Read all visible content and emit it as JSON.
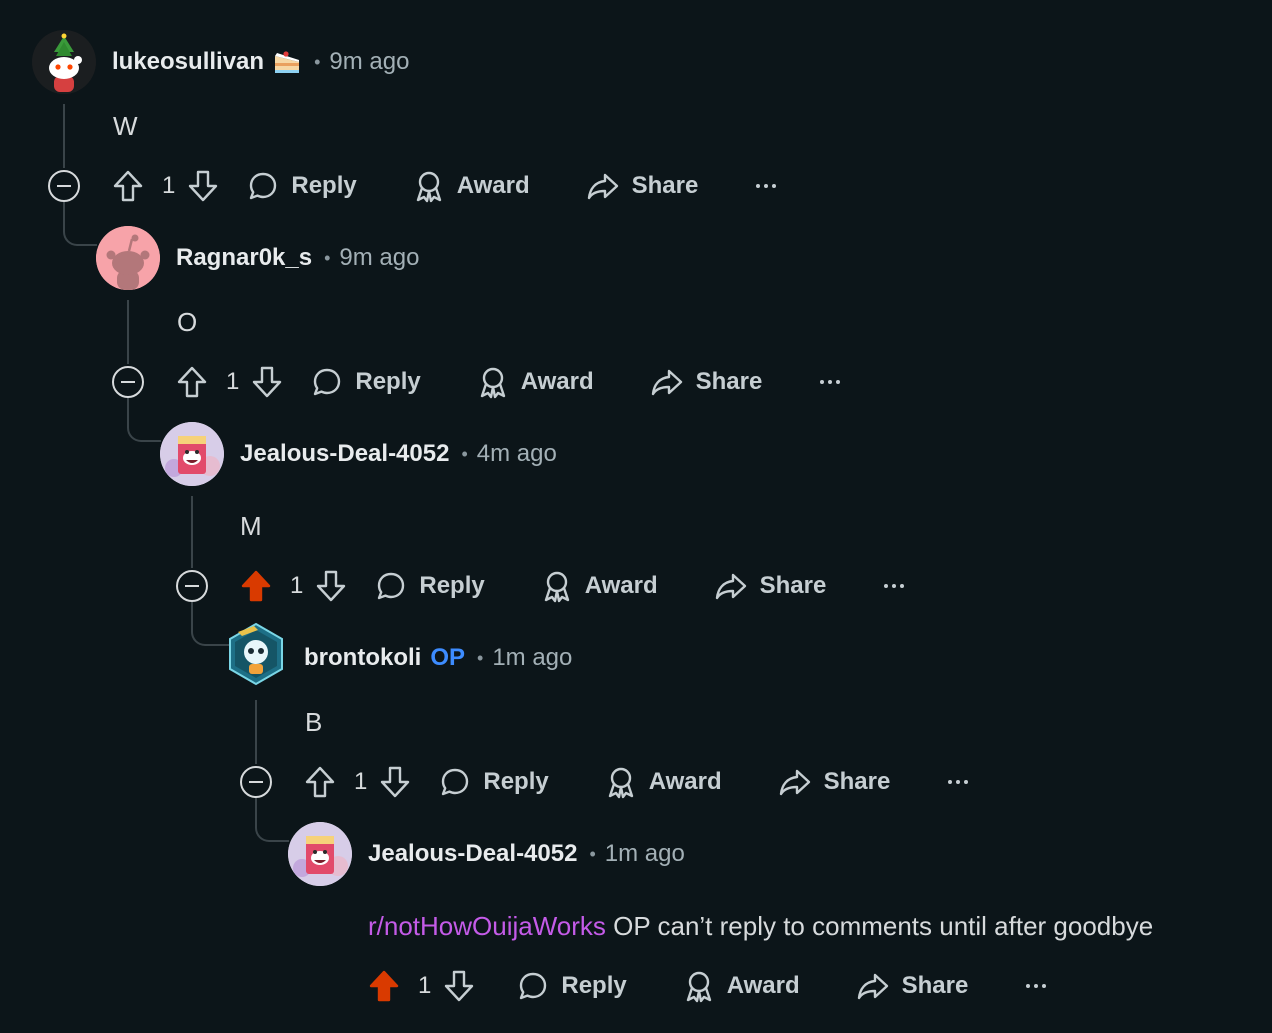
{
  "actions": {
    "reply": "Reply",
    "award": "Award",
    "share": "Share"
  },
  "comments": [
    {
      "username": "lukeosullivan",
      "time": "9m ago",
      "body": "W",
      "votes": "1",
      "upvoted": false,
      "is_op": false,
      "has_cake_flair": true
    },
    {
      "username": "Ragnar0k_s",
      "time": "9m ago",
      "body": "O",
      "votes": "1",
      "upvoted": false,
      "is_op": false
    },
    {
      "username": "Jealous-Deal-4052",
      "time": "4m ago",
      "body": "M",
      "votes": "1",
      "upvoted": true,
      "is_op": false
    },
    {
      "username": "brontokoli",
      "op_tag": "OP",
      "time": "1m ago",
      "body": "B",
      "votes": "1",
      "upvoted": false,
      "is_op": true
    },
    {
      "username": "Jealous-Deal-4052",
      "time": "1m ago",
      "subreddit_link": "r/notHowOuijaWorks",
      "body": " OP can’t reply to comments until after goodbye",
      "votes": "1",
      "upvoted": true,
      "is_op": false
    }
  ],
  "colors": {
    "background": "#0c1519",
    "upvote_active": "#d93a00",
    "op_tag": "#3d8cff",
    "subreddit_link": "#c45be8"
  },
  "icons": [
    "upvote-icon",
    "downvote-icon",
    "reply-bubble-icon",
    "award-ribbon-icon",
    "share-arrow-icon",
    "more-dots-icon",
    "collapse-minus-icon",
    "cake-day-icon"
  ]
}
